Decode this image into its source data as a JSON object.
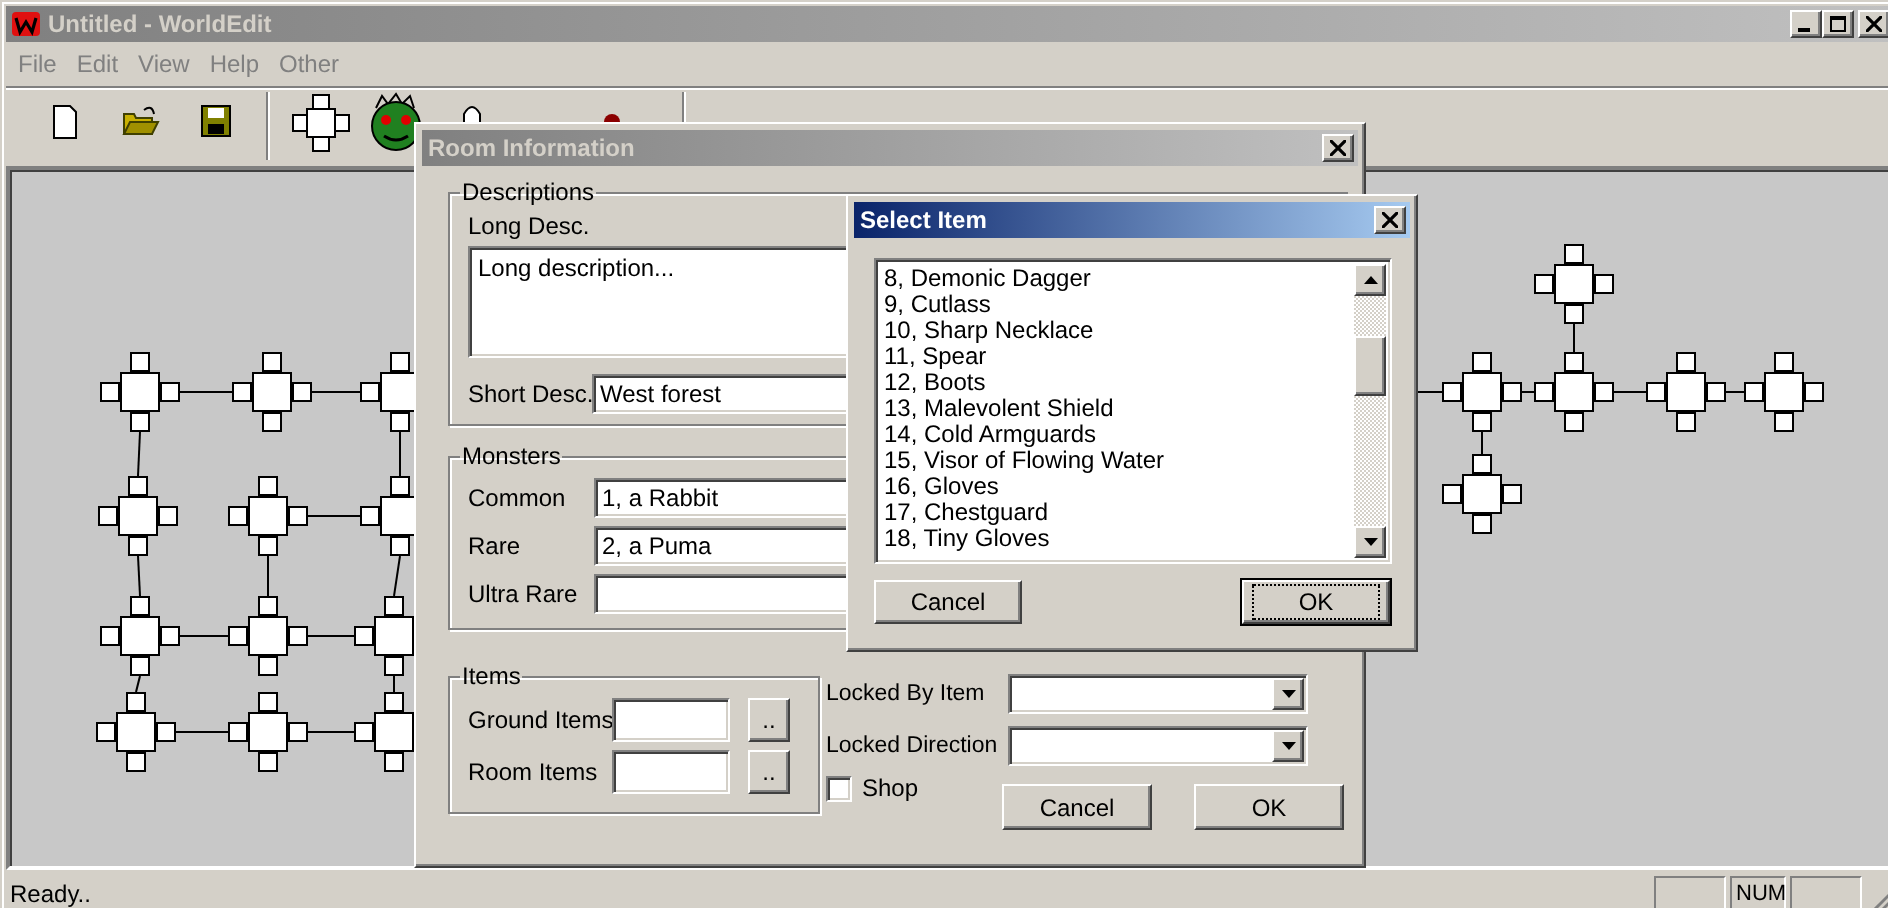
{
  "window": {
    "title": "Untitled - WorldEdit"
  },
  "menu": [
    {
      "label": "File"
    },
    {
      "label": "Edit"
    },
    {
      "label": "View"
    },
    {
      "label": "Help"
    },
    {
      "label": "Other"
    }
  ],
  "room_dialog": {
    "title": "Room Information",
    "active": false,
    "descriptions": {
      "label": "Descriptions",
      "long_label": "Long Desc.",
      "long_value": "Long description...",
      "short_label": "Short Desc.",
      "short_value": "West forest"
    },
    "monsters": {
      "label": "Monsters",
      "fields": [
        {
          "label": "Common",
          "value": "1, a Rabbit"
        },
        {
          "label": "Rare",
          "value": "2, a Puma"
        },
        {
          "label": "Ultra Rare"
        }
      ]
    },
    "items": {
      "label": "Items",
      "fields": [
        {
          "label": "Ground Items",
          "button": ".."
        },
        {
          "label": "Room Items",
          "button": ".."
        }
      ]
    },
    "locks": [
      {
        "label": "Locked By Item"
      },
      {
        "label": "Locked Direction"
      }
    ],
    "shop": {
      "label": "Shop",
      "checked": false
    },
    "buttons": [
      {
        "label": "Cancel",
        "default": false
      },
      {
        "label": "OK",
        "default": false
      }
    ]
  },
  "select_dialog": {
    "title": "Select Item",
    "active": true,
    "items": [
      "8, Demonic Dagger",
      "9, Cutlass",
      "10, Sharp Necklace",
      "11, Spear",
      "12, Boots",
      "13, Malevolent Shield",
      "14, Cold Armguards",
      "15, Visor of Flowing Water",
      "16, Gloves",
      "17, Chestguard",
      "18, Tiny Gloves"
    ],
    "buttons": [
      {
        "label": "Cancel",
        "default": false
      },
      {
        "label": "OK",
        "default": true
      }
    ]
  },
  "status_bar": {
    "text": "Ready..",
    "panes": [
      {
        "kind": "empty"
      },
      {
        "kind": "text",
        "label": "NUM"
      },
      {
        "kind": "empty"
      }
    ]
  }
}
